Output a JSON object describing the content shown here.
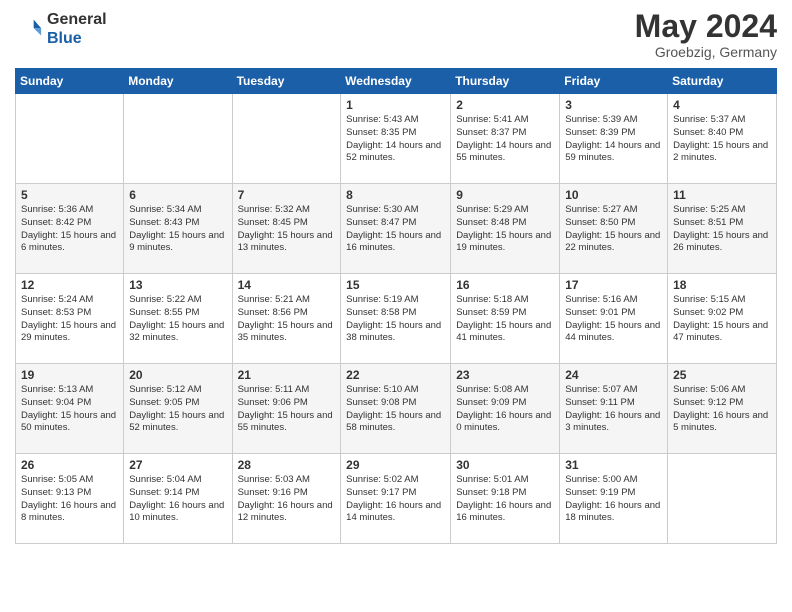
{
  "logo": {
    "general": "General",
    "blue": "Blue"
  },
  "title": "May 2024",
  "location": "Groebzig, Germany",
  "weekdays": [
    "Sunday",
    "Monday",
    "Tuesday",
    "Wednesday",
    "Thursday",
    "Friday",
    "Saturday"
  ],
  "weeks": [
    [
      {
        "day": "",
        "info": ""
      },
      {
        "day": "",
        "info": ""
      },
      {
        "day": "",
        "info": ""
      },
      {
        "day": "1",
        "info": "Sunrise: 5:43 AM\nSunset: 8:35 PM\nDaylight: 14 hours and 52 minutes."
      },
      {
        "day": "2",
        "info": "Sunrise: 5:41 AM\nSunset: 8:37 PM\nDaylight: 14 hours and 55 minutes."
      },
      {
        "day": "3",
        "info": "Sunrise: 5:39 AM\nSunset: 8:39 PM\nDaylight: 14 hours and 59 minutes."
      },
      {
        "day": "4",
        "info": "Sunrise: 5:37 AM\nSunset: 8:40 PM\nDaylight: 15 hours and 2 minutes."
      }
    ],
    [
      {
        "day": "5",
        "info": "Sunrise: 5:36 AM\nSunset: 8:42 PM\nDaylight: 15 hours and 6 minutes."
      },
      {
        "day": "6",
        "info": "Sunrise: 5:34 AM\nSunset: 8:43 PM\nDaylight: 15 hours and 9 minutes."
      },
      {
        "day": "7",
        "info": "Sunrise: 5:32 AM\nSunset: 8:45 PM\nDaylight: 15 hours and 13 minutes."
      },
      {
        "day": "8",
        "info": "Sunrise: 5:30 AM\nSunset: 8:47 PM\nDaylight: 15 hours and 16 minutes."
      },
      {
        "day": "9",
        "info": "Sunrise: 5:29 AM\nSunset: 8:48 PM\nDaylight: 15 hours and 19 minutes."
      },
      {
        "day": "10",
        "info": "Sunrise: 5:27 AM\nSunset: 8:50 PM\nDaylight: 15 hours and 22 minutes."
      },
      {
        "day": "11",
        "info": "Sunrise: 5:25 AM\nSunset: 8:51 PM\nDaylight: 15 hours and 26 minutes."
      }
    ],
    [
      {
        "day": "12",
        "info": "Sunrise: 5:24 AM\nSunset: 8:53 PM\nDaylight: 15 hours and 29 minutes."
      },
      {
        "day": "13",
        "info": "Sunrise: 5:22 AM\nSunset: 8:55 PM\nDaylight: 15 hours and 32 minutes."
      },
      {
        "day": "14",
        "info": "Sunrise: 5:21 AM\nSunset: 8:56 PM\nDaylight: 15 hours and 35 minutes."
      },
      {
        "day": "15",
        "info": "Sunrise: 5:19 AM\nSunset: 8:58 PM\nDaylight: 15 hours and 38 minutes."
      },
      {
        "day": "16",
        "info": "Sunrise: 5:18 AM\nSunset: 8:59 PM\nDaylight: 15 hours and 41 minutes."
      },
      {
        "day": "17",
        "info": "Sunrise: 5:16 AM\nSunset: 9:01 PM\nDaylight: 15 hours and 44 minutes."
      },
      {
        "day": "18",
        "info": "Sunrise: 5:15 AM\nSunset: 9:02 PM\nDaylight: 15 hours and 47 minutes."
      }
    ],
    [
      {
        "day": "19",
        "info": "Sunrise: 5:13 AM\nSunset: 9:04 PM\nDaylight: 15 hours and 50 minutes."
      },
      {
        "day": "20",
        "info": "Sunrise: 5:12 AM\nSunset: 9:05 PM\nDaylight: 15 hours and 52 minutes."
      },
      {
        "day": "21",
        "info": "Sunrise: 5:11 AM\nSunset: 9:06 PM\nDaylight: 15 hours and 55 minutes."
      },
      {
        "day": "22",
        "info": "Sunrise: 5:10 AM\nSunset: 9:08 PM\nDaylight: 15 hours and 58 minutes."
      },
      {
        "day": "23",
        "info": "Sunrise: 5:08 AM\nSunset: 9:09 PM\nDaylight: 16 hours and 0 minutes."
      },
      {
        "day": "24",
        "info": "Sunrise: 5:07 AM\nSunset: 9:11 PM\nDaylight: 16 hours and 3 minutes."
      },
      {
        "day": "25",
        "info": "Sunrise: 5:06 AM\nSunset: 9:12 PM\nDaylight: 16 hours and 5 minutes."
      }
    ],
    [
      {
        "day": "26",
        "info": "Sunrise: 5:05 AM\nSunset: 9:13 PM\nDaylight: 16 hours and 8 minutes."
      },
      {
        "day": "27",
        "info": "Sunrise: 5:04 AM\nSunset: 9:14 PM\nDaylight: 16 hours and 10 minutes."
      },
      {
        "day": "28",
        "info": "Sunrise: 5:03 AM\nSunset: 9:16 PM\nDaylight: 16 hours and 12 minutes."
      },
      {
        "day": "29",
        "info": "Sunrise: 5:02 AM\nSunset: 9:17 PM\nDaylight: 16 hours and 14 minutes."
      },
      {
        "day": "30",
        "info": "Sunrise: 5:01 AM\nSunset: 9:18 PM\nDaylight: 16 hours and 16 minutes."
      },
      {
        "day": "31",
        "info": "Sunrise: 5:00 AM\nSunset: 9:19 PM\nDaylight: 16 hours and 18 minutes."
      },
      {
        "day": "",
        "info": ""
      }
    ]
  ]
}
